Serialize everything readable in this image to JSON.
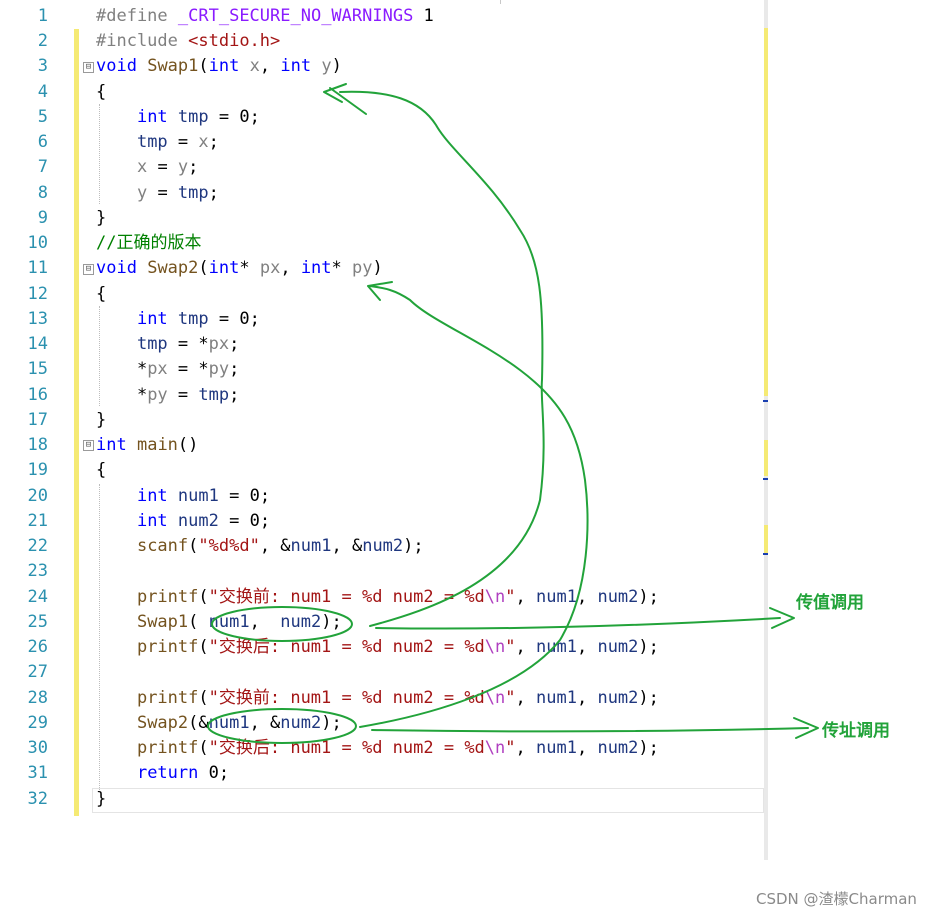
{
  "editor": {
    "line_numbers": [
      "1",
      "2",
      "3",
      "4",
      "5",
      "6",
      "7",
      "8",
      "9",
      "10",
      "11",
      "12",
      "13",
      "14",
      "15",
      "16",
      "17",
      "18",
      "19",
      "20",
      "21",
      "22",
      "23",
      "24",
      "25",
      "26",
      "27",
      "28",
      "29",
      "30",
      "31",
      "32"
    ],
    "code": {
      "l1": [
        "#define",
        " ",
        "_CRT_SECURE_NO_WARNINGS",
        " 1"
      ],
      "l2": [
        "#include",
        " ",
        "<stdio.h>"
      ],
      "l3": [
        "void",
        " ",
        "Swap1",
        "(",
        "int",
        " ",
        "x",
        ", ",
        "int",
        " ",
        "y",
        ")"
      ],
      "l4": [
        "{"
      ],
      "l5": [
        "    ",
        "int",
        " ",
        "tmp",
        " = 0;"
      ],
      "l6": [
        "    ",
        "tmp",
        " = ",
        "x",
        ";"
      ],
      "l7": [
        "    ",
        "x",
        " = ",
        "y",
        ";"
      ],
      "l8": [
        "    ",
        "y",
        " = ",
        "tmp",
        ";"
      ],
      "l9": [
        "}"
      ],
      "l10": [
        "//正确的版本"
      ],
      "l11": [
        "void",
        " ",
        "Swap2",
        "(",
        "int",
        "* ",
        "px",
        ", ",
        "int",
        "* ",
        "py",
        ")"
      ],
      "l12": [
        "{"
      ],
      "l13": [
        "    ",
        "int",
        " ",
        "tmp",
        " = 0;"
      ],
      "l14": [
        "    ",
        "tmp",
        " = *",
        "px",
        ";"
      ],
      "l15": [
        "    *",
        "px",
        " = *",
        "py",
        ";"
      ],
      "l16": [
        "    *",
        "py",
        " = ",
        "tmp",
        ";"
      ],
      "l17": [
        "}"
      ],
      "l18": [
        "int",
        " ",
        "main",
        "()"
      ],
      "l19": [
        "{"
      ],
      "l20": [
        "    ",
        "int",
        " ",
        "num1",
        " = 0;"
      ],
      "l21": [
        "    ",
        "int",
        " ",
        "num2",
        " = 0;"
      ],
      "l22": [
        "    ",
        "scanf",
        "(",
        "\"%d%d\"",
        ", &",
        "num1",
        ", &",
        "num2",
        ");"
      ],
      "l23": [
        ""
      ],
      "l24": [
        "    ",
        "printf",
        "(",
        "\"交换前: num1 = %d num2 = %d",
        "\\n",
        "\"",
        ", ",
        "num1",
        ", ",
        "num2",
        ");"
      ],
      "l25": [
        "    ",
        "Swap1",
        "( ",
        "num1",
        ",  ",
        "num2",
        ");"
      ],
      "l26": [
        "    ",
        "printf",
        "(",
        "\"交换后: num1 = %d num2 = %d",
        "\\n",
        "\"",
        ", ",
        "num1",
        ", ",
        "num2",
        ");"
      ],
      "l27": [
        ""
      ],
      "l28": [
        "    ",
        "printf",
        "(",
        "\"交换前: num1 = %d num2 = %d",
        "\\n",
        "\"",
        ", ",
        "num1",
        ", ",
        "num2",
        ");"
      ],
      "l29": [
        "    ",
        "Swap2",
        "(&",
        "num1",
        ", &",
        "num2",
        ");"
      ],
      "l30": [
        "    ",
        "printf",
        "(",
        "\"交换后: num1 = %d num2 = %d",
        "\\n",
        "\"",
        ", ",
        "num1",
        ", ",
        "num2",
        ");"
      ],
      "l31": [
        "    ",
        "return",
        " 0;"
      ],
      "l32": [
        "}"
      ]
    }
  },
  "annotations": {
    "call_by_value": "传值调用",
    "call_by_address": "传址调用",
    "ink_color": "#22a33a"
  },
  "watermark": "CSDN @渣檬Charman",
  "colors": {
    "keyword": "#0000ff",
    "string": "#a31515",
    "comment": "#008000",
    "line_number": "#2b91af",
    "change_bar": "#f5ea74"
  }
}
